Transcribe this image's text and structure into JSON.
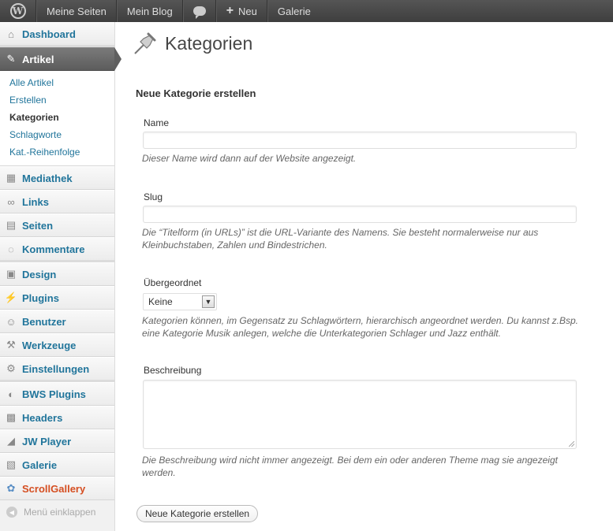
{
  "adminbar": {
    "items": [
      "Meine Seiten",
      "Mein Blog",
      "Neu",
      "Galerie"
    ]
  },
  "sidebar": {
    "dashboard": "Dashboard",
    "artikel": "Artikel",
    "submenu": [
      "Alle Artikel",
      "Erstellen",
      "Kategorien",
      "Schlagworte",
      "Kat.-Reihenfolge"
    ],
    "items": [
      "Mediathek",
      "Links",
      "Seiten",
      "Kommentare",
      "Design",
      "Plugins",
      "Benutzer",
      "Werkzeuge",
      "Einstellungen",
      "BWS Plugins",
      "Headers",
      "JW Player",
      "Galerie",
      "ScrollGallery"
    ],
    "collapse": "Menü einklappen"
  },
  "main": {
    "title": "Kategorien",
    "section_title": "Neue Kategorie erstellen",
    "name_label": "Name",
    "name_help": "Dieser Name wird dann auf der Website angezeigt.",
    "slug_label": "Slug",
    "slug_help": "Die “Titelform (in URLs)” ist die URL-Variante des Namens. Sie besteht normalerweise nur aus Kleinbuchstaben, Zahlen und Bindestrichen.",
    "parent_label": "Übergeordnet",
    "parent_value": "Keine",
    "parent_help": "Kategorien können, im Gegensatz zu Schlagwörtern, hierarchisch angeordnet werden. Du kannst z.Bsp. eine Kategorie Musik anlegen, welche die Unterkategorien Schlager und Jazz enthält.",
    "desc_label": "Beschreibung",
    "desc_help": "Die Beschreibung wird nicht immer angezeigt. Bei dem ein oder anderen Theme mag sie angezeigt werden.",
    "submit_label": "Neue Kategorie erstellen"
  },
  "colors": {
    "link": "#21759b",
    "active_menu": "#6d6d6d",
    "highlight": "#d54e21"
  }
}
